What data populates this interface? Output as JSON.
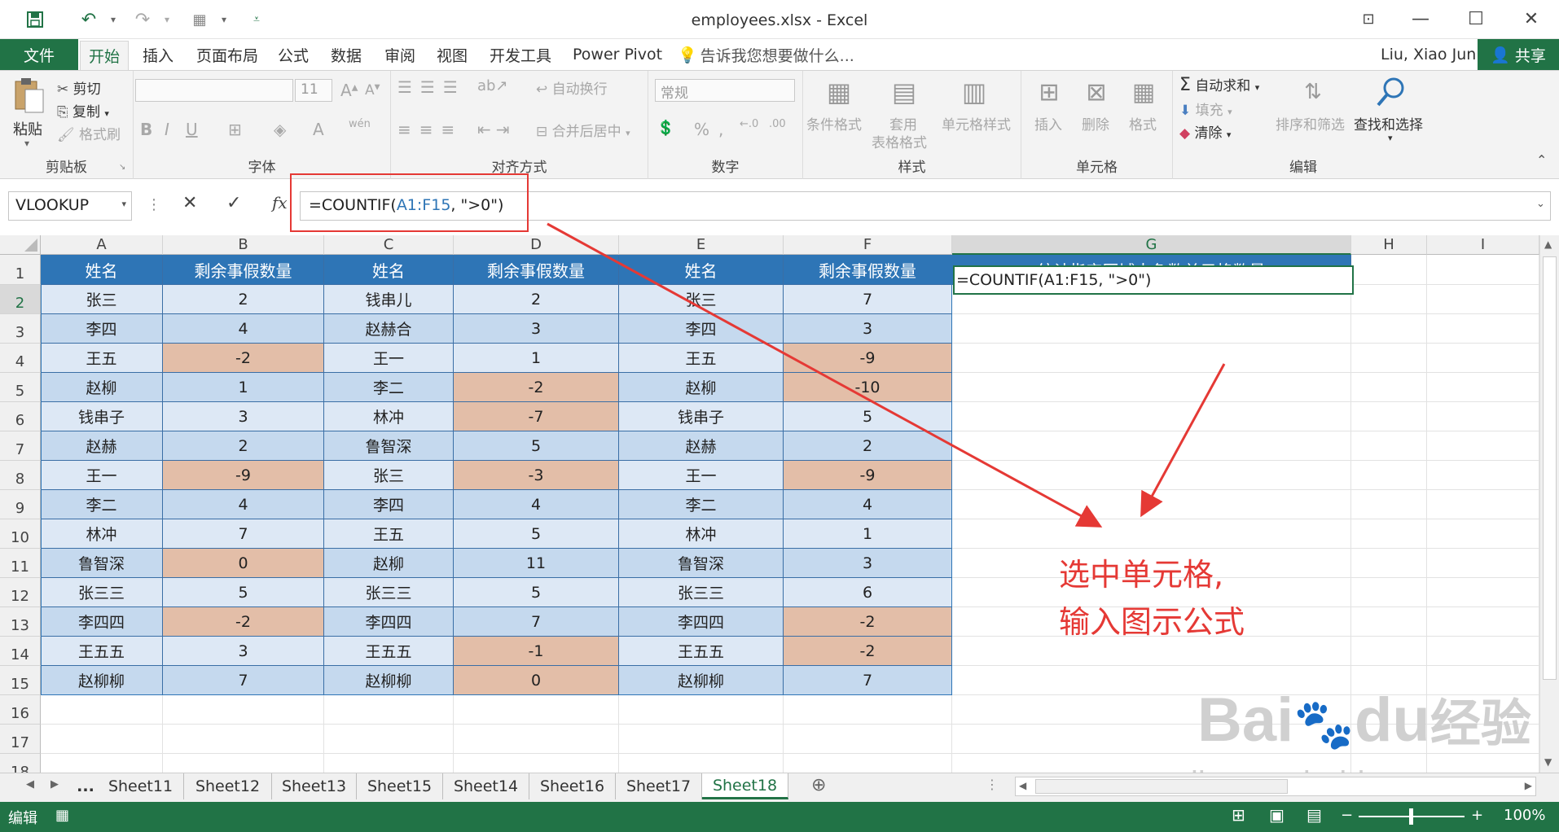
{
  "window": {
    "title": "employees.xlsx - Excel",
    "user": "Liu, Xiao Jun",
    "share": "共享"
  },
  "menu": {
    "file": "文件",
    "tabs": [
      "开始",
      "插入",
      "页面布局",
      "公式",
      "数据",
      "审阅",
      "视图",
      "开发工具",
      "Power Pivot"
    ],
    "tell_me": "告诉我您想要做什么..."
  },
  "ribbon": {
    "clipboard": {
      "label": "剪贴板",
      "paste": "粘贴",
      "cut": "剪切",
      "copy": "复制",
      "format_painter": "格式刷"
    },
    "font": {
      "label": "字体",
      "size": "11",
      "bold": "B",
      "italic": "I",
      "underline": "U",
      "font_color": "A"
    },
    "alignment": {
      "label": "对齐方式",
      "wrap": "自动换行",
      "merge": "合并后居中"
    },
    "number": {
      "label": "数字",
      "format": "常规"
    },
    "styles": {
      "label": "样式",
      "conditional": "条件格式",
      "table_line1": "套用",
      "table_line2": "表格格式",
      "cell_styles": "单元格样式"
    },
    "cells": {
      "label": "单元格",
      "insert": "插入",
      "delete": "删除",
      "format": "格式"
    },
    "editing": {
      "label": "编辑",
      "autosum": "自动求和",
      "fill": "填充",
      "clear": "清除",
      "sort": "排序和筛选",
      "find": "查找和选择"
    }
  },
  "formula_bar": {
    "name_box": "VLOOKUP",
    "cancel": "✕",
    "enter": "✓",
    "fx": "fx",
    "formula_prefix": "=COUNTIF(",
    "formula_ref": "A1:F15",
    "formula_suffix": ", \">0\")"
  },
  "columns": [
    "A",
    "B",
    "C",
    "D",
    "E",
    "F",
    "G",
    "H",
    "I"
  ],
  "rows": [
    "1",
    "2",
    "3",
    "4",
    "5",
    "6",
    "7",
    "8",
    "9",
    "10",
    "11",
    "12",
    "13",
    "14",
    "15",
    "16",
    "17",
    "18"
  ],
  "table": {
    "headers": [
      "姓名",
      "剩余事假数量",
      "姓名",
      "剩余事假数量",
      "姓名",
      "剩余事假数量"
    ],
    "rows": [
      [
        "张三",
        "2",
        "钱串儿",
        "2",
        "张三",
        "7"
      ],
      [
        "李四",
        "4",
        "赵赫合",
        "3",
        "李四",
        "3"
      ],
      [
        "王五",
        "-2",
        "王一",
        "1",
        "王五",
        "-9"
      ],
      [
        "赵柳",
        "1",
        "李二",
        "-2",
        "赵柳",
        "-10"
      ],
      [
        "钱串子",
        "3",
        "林冲",
        "-7",
        "钱串子",
        "5"
      ],
      [
        "赵赫",
        "2",
        "鲁智深",
        "5",
        "赵赫",
        "2"
      ],
      [
        "王一",
        "-9",
        "张三",
        "-3",
        "王一",
        "-9"
      ],
      [
        "李二",
        "4",
        "李四",
        "4",
        "李二",
        "4"
      ],
      [
        "林冲",
        "7",
        "王五",
        "5",
        "林冲",
        "1"
      ],
      [
        "鲁智深",
        "0",
        "赵柳",
        "11",
        "鲁智深",
        "3"
      ],
      [
        "张三三",
        "5",
        "张三三",
        "5",
        "张三三",
        "6"
      ],
      [
        "李四四",
        "-2",
        "李四四",
        "7",
        "李四四",
        "-2"
      ],
      [
        "王五五",
        "3",
        "王五五",
        "-1",
        "王五五",
        "-2"
      ],
      [
        "赵柳柳",
        "7",
        "赵柳柳",
        "0",
        "赵柳柳",
        "7"
      ]
    ]
  },
  "g_column": {
    "header": "统计指定区域中负数单元格数量",
    "g2": "=COUNTIF(A1:F15, \">0\")"
  },
  "sheet_tabs": [
    "...",
    "Sheet11",
    "Sheet12",
    "Sheet13",
    "Sheet15",
    "Sheet14",
    "Sheet16",
    "Sheet17",
    "Sheet18"
  ],
  "active_sheet": "Sheet18",
  "status": {
    "mode": "编辑",
    "zoom": "100%"
  },
  "annotation": {
    "line1": "选中单元格,",
    "line2": "输入图示公式"
  },
  "watermark": {
    "brand": "Bai",
    "brand2": "du",
    "brand_cn": "经验",
    "url": "jingyan.baidu.com"
  },
  "colors": {
    "excel_green": "#217346",
    "header_blue": "#2e75b6",
    "row_light": "#dde8f5",
    "row_dark": "#c5d9ee",
    "negative": "#e3bea8",
    "annotation_red": "#e53935"
  }
}
